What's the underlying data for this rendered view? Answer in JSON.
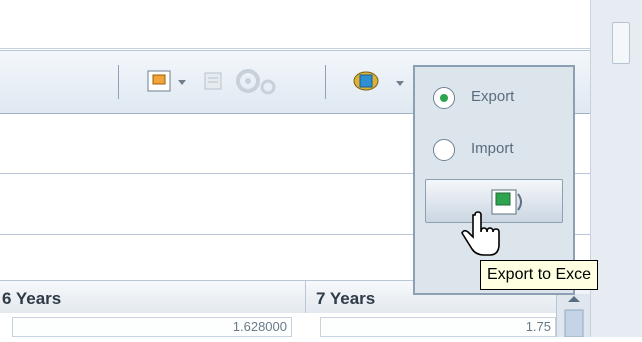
{
  "grid": {
    "columns": [
      {
        "label": "6 Years"
      },
      {
        "label": "7 Years"
      }
    ],
    "row": {
      "cells": [
        "1.628000",
        "1.75"
      ]
    }
  },
  "export_menu": {
    "options": [
      {
        "label": "Export",
        "selected": true
      },
      {
        "label": "Import",
        "selected": false
      }
    ],
    "excel_button": {
      "icon": "excel-icon"
    }
  },
  "tooltip": {
    "text": "Export to Exce"
  },
  "colors": {
    "accent": "#2ea44f",
    "toolbar_bg": "#dfe8f1",
    "menu_bg": "#dce4ec"
  }
}
